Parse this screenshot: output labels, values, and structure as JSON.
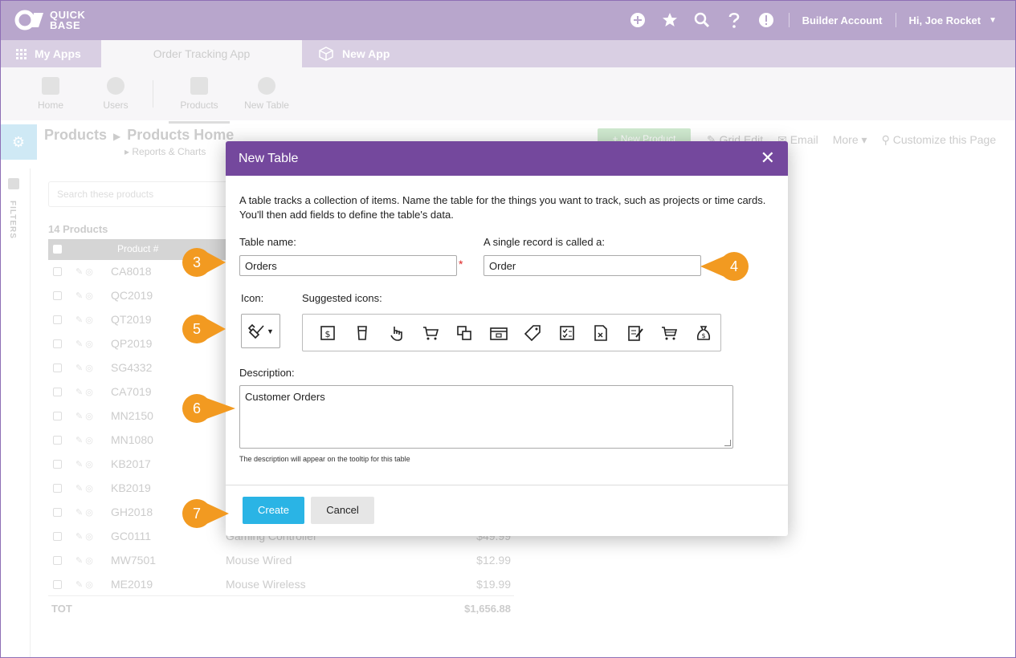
{
  "topbar": {
    "logo_line1": "QUICK",
    "logo_line2": "BASE",
    "account_link": "Builder Account",
    "user_greeting": "Hi, Joe Rocket"
  },
  "appbar": {
    "my_apps": "My Apps",
    "active_app": "Order Tracking App",
    "new_app": "New App"
  },
  "table_nav": {
    "items": [
      {
        "label": "Home"
      },
      {
        "label": "Users"
      },
      {
        "label": "Products"
      },
      {
        "label": "New Table"
      }
    ]
  },
  "page_header": {
    "crumb_root": "Products",
    "crumb_arrow": "▶",
    "crumb_current": "Products Home",
    "subcrumb": "▸ Reports & Charts",
    "new_record": "+ New Product",
    "grid_edit": "Grid Edit",
    "email": "Email",
    "more": "More ▾",
    "customize": "Customize this Page"
  },
  "filters_label": "FILTERS",
  "products": {
    "search_placeholder": "Search these products",
    "count": "14 Products",
    "column_header": "Product #",
    "rows": [
      {
        "code": "CA8018",
        "name": "",
        "price": ""
      },
      {
        "code": "QC2019",
        "name": "",
        "price": ""
      },
      {
        "code": "QT2019",
        "name": "",
        "price": ""
      },
      {
        "code": "QP2019",
        "name": "",
        "price": ""
      },
      {
        "code": "SG4332",
        "name": "",
        "price": ""
      },
      {
        "code": "CA7019",
        "name": "",
        "price": ""
      },
      {
        "code": "MN2150",
        "name": "",
        "price": ""
      },
      {
        "code": "MN1080",
        "name": "",
        "price": ""
      },
      {
        "code": "KB2017",
        "name": "",
        "price": ""
      },
      {
        "code": "KB2019",
        "name": "",
        "price": ""
      },
      {
        "code": "GH2018",
        "name": "",
        "price": ""
      },
      {
        "code": "GC0111",
        "name": "Gaming Controller",
        "price": "$49.99"
      },
      {
        "code": "MW7501",
        "name": "Mouse Wired",
        "price": "$12.99"
      },
      {
        "code": "ME2019",
        "name": "Mouse Wireless",
        "price": "$19.99"
      }
    ],
    "total_label": "TOT",
    "total_value": "$1,656.88"
  },
  "modal": {
    "title": "New Table",
    "close_glyph": "✕",
    "intro": "A table tracks a collection of items. Name the table for the things you want to track, such as projects or time cards. You'll then add fields to define the table's data.",
    "table_name_label": "Table name:",
    "table_name_value": "Orders",
    "required_mark": "*",
    "record_label": "A single record is called a:",
    "record_value": "Order",
    "icon_label": "Icon:",
    "suggested_label": "Suggested icons:",
    "suggested_icons": [
      "receipt-icon",
      "cup-icon",
      "pointer-hand-icon",
      "cart-icon",
      "bill-icon",
      "register-icon",
      "tag-icon",
      "checklist-icon",
      "spreadsheet-icon",
      "notepad-icon",
      "full-cart-icon",
      "money-bag-icon"
    ],
    "description_label": "Description:",
    "description_value": "Customer Orders",
    "description_hint": "The description will appear on the tooltip for this table",
    "create_label": "Create",
    "cancel_label": "Cancel"
  },
  "callouts": [
    {
      "number": "3"
    },
    {
      "number": "4"
    },
    {
      "number": "5"
    },
    {
      "number": "6"
    },
    {
      "number": "7"
    }
  ],
  "colors": {
    "modal_header": "#74489d",
    "create_button": "#2ab4e5",
    "callout": "#f29a21",
    "topbar": "#b8a6cc"
  }
}
